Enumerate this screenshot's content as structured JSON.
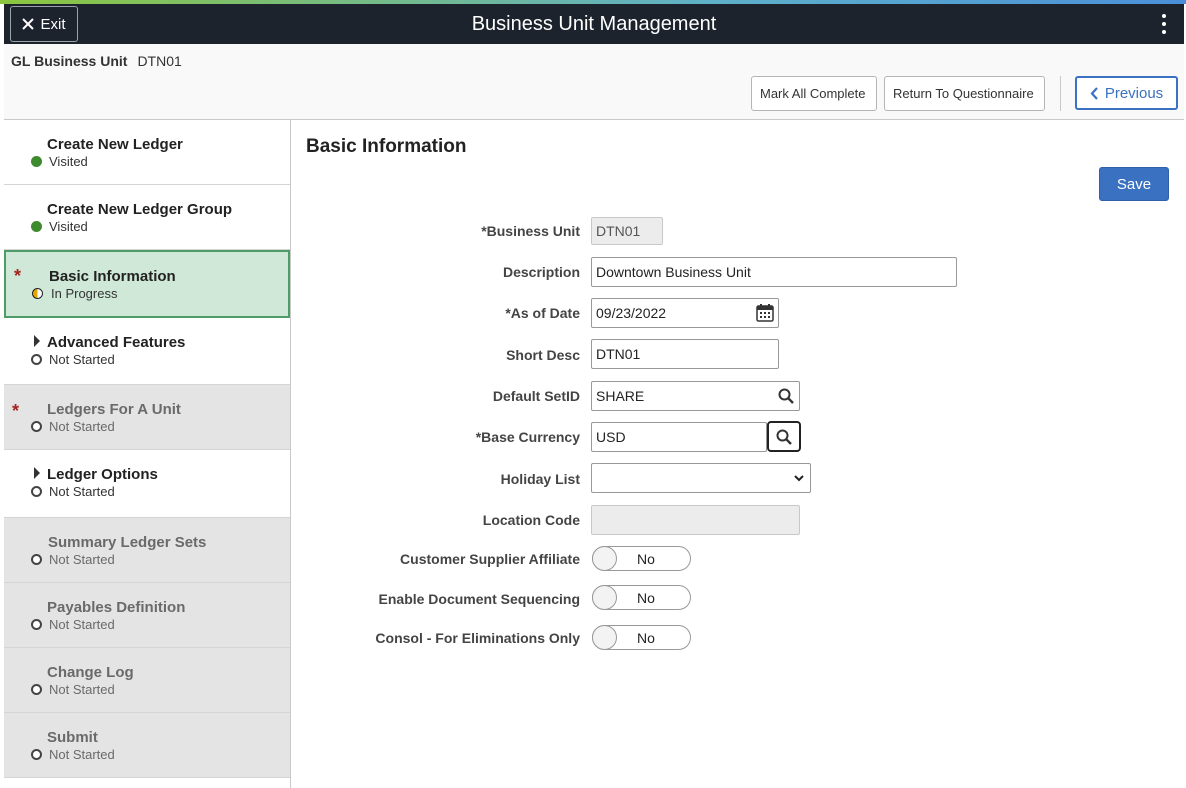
{
  "header": {
    "title": "Business Unit Management",
    "exit_label": "Exit",
    "business_unit_label": "GL Business Unit",
    "business_unit_value": "DTN01",
    "mark_all_complete_label": "Mark All Complete",
    "return_to_questionnaire_label": "Return To Questionnaire",
    "previous_label": "Previous"
  },
  "sidebar": {
    "items": [
      {
        "label": "Create New Ledger",
        "status": "Visited"
      },
      {
        "label": "Create New Ledger Group",
        "status": "Visited"
      },
      {
        "label": "Basic Information",
        "status": "In Progress"
      },
      {
        "label": "Advanced Features",
        "status": "Not Started"
      },
      {
        "label": "Ledgers For A Unit",
        "status": "Not Started"
      },
      {
        "label": "Ledger Options",
        "status": "Not Started"
      },
      {
        "label": "Summary Ledger Sets",
        "status": "Not Started"
      },
      {
        "label": "Payables Definition",
        "status": "Not Started"
      },
      {
        "label": "Change Log",
        "status": "Not Started"
      },
      {
        "label": "Submit",
        "status": "Not Started"
      }
    ],
    "required_marker": "*"
  },
  "main": {
    "section_title": "Basic Information",
    "save_label": "Save",
    "fields": {
      "business_unit": {
        "label": "*Business Unit",
        "value": "DTN01"
      },
      "description": {
        "label": "Description",
        "value": "Downtown Business Unit"
      },
      "as_of_date": {
        "label": "*As of Date",
        "value": "09/23/2022"
      },
      "short_desc": {
        "label": "Short Desc",
        "value": "DTN01"
      },
      "default_setid": {
        "label": "Default SetID",
        "value": "SHARE"
      },
      "base_currency": {
        "label": "*Base Currency",
        "value": "USD"
      },
      "holiday_list": {
        "label": "Holiday List",
        "value": ""
      },
      "location_code": {
        "label": "Location Code",
        "value": ""
      },
      "customer_supplier_affiliate": {
        "label": "Customer Supplier Affiliate",
        "value": "No"
      },
      "enable_document_sequencing": {
        "label": "Enable Document Sequencing",
        "value": "No"
      },
      "consol_for_eliminations_only": {
        "label": "Consol - For Eliminations Only",
        "value": "No"
      }
    }
  },
  "colors": {
    "title_bar": "#1c232c",
    "accent": "#3a71c0",
    "active_step_bg": "#cfe8d8",
    "visited": "#3d8b2e",
    "required": "#a3241d"
  }
}
